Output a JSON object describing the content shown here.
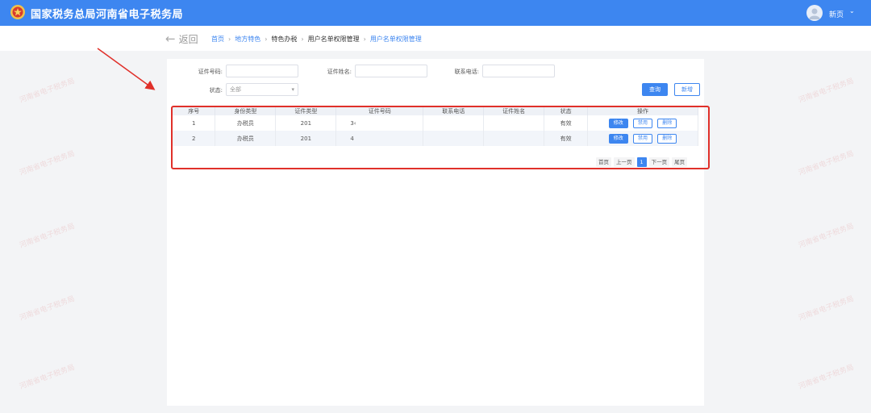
{
  "header": {
    "title": "国家税务总局河南省电子税务局",
    "user_name": "新页"
  },
  "breadcrumb": {
    "back_label": "返回",
    "items": [
      "首页",
      "地方特色",
      "特色办税",
      "用户名单权限管理",
      "用户名单权限管理"
    ]
  },
  "filters": {
    "id_number_label": "证件号码:",
    "id_name_label": "证件姓名:",
    "phone_label": "联系电话:",
    "status_label": "状态:",
    "status_value": "全部",
    "query_button": "查询",
    "add_button": "新增"
  },
  "table": {
    "columns": [
      "序号",
      "身份类型",
      "证件类型",
      "证件号码",
      "联系电话",
      "证件姓名",
      "状态",
      "操作"
    ],
    "rows": [
      {
        "index": "1",
        "identity_type": "办税员",
        "id_type": "201",
        "id_number": "3‹",
        "phone": "",
        "name": "",
        "status": "有效"
      },
      {
        "index": "2",
        "identity_type": "办税员",
        "id_type": "201",
        "id_number": "4",
        "phone": "",
        "name": "",
        "status": "有效"
      }
    ],
    "actions": {
      "edit": "修改",
      "disable": "禁用",
      "delete": "删除"
    }
  },
  "pagination": {
    "first": "首页",
    "prev": "上一页",
    "current": "1",
    "next": "下一页",
    "last": "尾页"
  },
  "watermark": "河南省电子税务局",
  "colors": {
    "brand_blue": "#3d86f0",
    "highlight_red": "#e0302a",
    "page_bg": "#f3f4f6"
  }
}
